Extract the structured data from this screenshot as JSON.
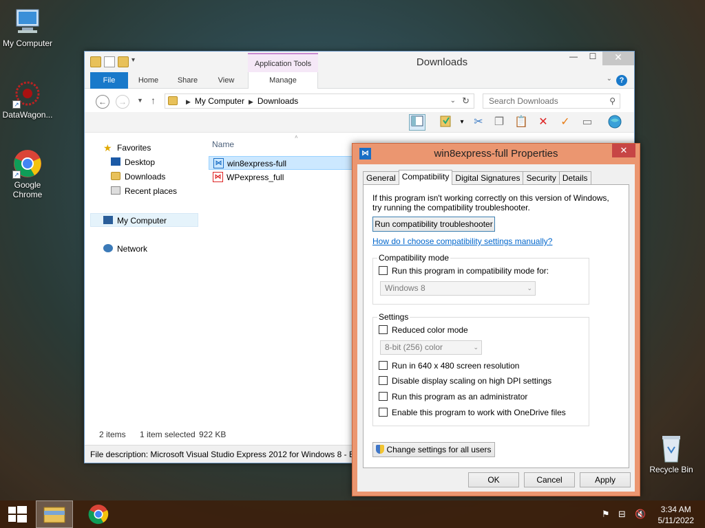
{
  "desktop": {
    "icons": [
      {
        "label": "My Computer"
      },
      {
        "label": "DataWagon..."
      },
      {
        "label": "Google Chrome"
      },
      {
        "label": "Recycle Bin"
      }
    ]
  },
  "explorer": {
    "title": "Downloads",
    "context_tab_group": "Application Tools",
    "tabs": [
      "File",
      "Home",
      "Share",
      "View",
      "Manage"
    ],
    "address": {
      "crumbs": [
        "My Computer",
        "Downloads"
      ]
    },
    "search_placeholder": "Search Downloads",
    "nav": {
      "favorites": "Favorites",
      "desktop": "Desktop",
      "downloads": "Downloads",
      "recent": "Recent places",
      "computer": "My Computer",
      "network": "Network"
    },
    "columns": {
      "name": "Name"
    },
    "files": [
      {
        "name": "win8express-full",
        "selected": true
      },
      {
        "name": "WPexpress_full",
        "selected": false
      }
    ],
    "status": {
      "count": "2 items",
      "selected": "1 item selected",
      "size": "922 KB"
    },
    "description": "File description: Microsoft Visual Studio Express 2012 for Windows 8 - EN"
  },
  "props": {
    "title": "win8express-full Properties",
    "tabs": [
      "General",
      "Compatibility",
      "Digital Signatures",
      "Security",
      "Details"
    ],
    "active_tab": "Compatibility",
    "intro_line1": "If this program isn't working correctly on this version of Windows,",
    "intro_line2": "try running the compatibility troubleshooter.",
    "troubleshooter_button": "Run compatibility troubleshooter",
    "help_link": "How do I choose compatibility settings manually?",
    "compat_mode": {
      "group_label": "Compatibility mode",
      "checkbox": "Run this program in compatibility mode for:",
      "select_value": "Windows 8"
    },
    "settings": {
      "group_label": "Settings",
      "reduced_color": "Reduced color mode",
      "color_select": "8-bit (256) color",
      "res_640": "Run in 640 x 480 screen resolution",
      "dpi": "Disable display scaling on high DPI settings",
      "admin": "Run this program as an administrator",
      "onedrive": "Enable this program to work with OneDrive files"
    },
    "change_all_button": "Change settings for all users",
    "ok": "OK",
    "cancel": "Cancel",
    "apply": "Apply"
  },
  "taskbar": {
    "time": "3:34 AM",
    "date": "5/11/2022"
  },
  "colors": {
    "accent": "#1979ca",
    "dialog_frame": "#eb9670",
    "taskbar": "#3c1e0a"
  }
}
